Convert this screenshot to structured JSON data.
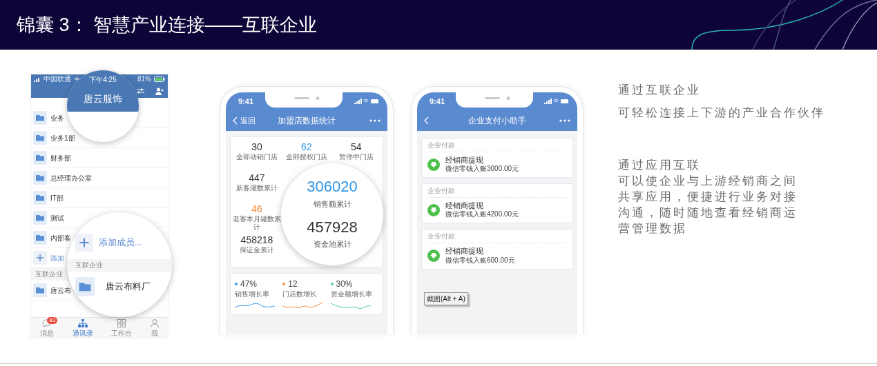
{
  "header": {
    "title": "锦囊 3： 智慧产业连接——互联企业"
  },
  "contacts_phone": {
    "carrier": "中国联通",
    "battery": "81%",
    "groups": [
      {
        "label": "业务"
      },
      {
        "label": "业务1部"
      },
      {
        "label": "财务部"
      },
      {
        "label": "总经理办公室"
      },
      {
        "label": "IT部"
      },
      {
        "label": "测试"
      },
      {
        "label": "内部客"
      }
    ],
    "add_member": "添加",
    "section": "互联企业",
    "partners": [
      {
        "label": "唐云布"
      }
    ],
    "tabs": [
      {
        "label": "消息",
        "badge": "83",
        "selected": false
      },
      {
        "label": "通讯录",
        "selected": true
      },
      {
        "label": "工作台",
        "selected": false
      },
      {
        "label": "我",
        "selected": false
      }
    ],
    "magnifier_top": {
      "time": "下午4:25",
      "title": "唐云服饰"
    },
    "magnifier_bottom": {
      "add_member": "添加成员...",
      "section": "互联企业",
      "partner": "唐云布料厂"
    }
  },
  "dashboard_phone": {
    "time": "9:41",
    "back": "返回",
    "title": "加盟店数据统计",
    "stat_rows": [
      [
        {
          "value": "30",
          "label": "全部动销门店"
        },
        {
          "value": "62",
          "label": "全部授权门店",
          "color": "#2f96e8"
        },
        {
          "value": "54",
          "label": "暂停中门店"
        }
      ],
      [
        {
          "value": "447",
          "label": "新客灌数累计"
        }
      ],
      [
        {
          "value": "46",
          "label": "老客本月罐数累计",
          "color": "#f08a3c"
        }
      ],
      [
        {
          "value": "458218",
          "label": "保证金累计"
        }
      ]
    ],
    "magnifier": [
      {
        "value": "306020",
        "label": "销售额累计",
        "color": "#2f96e8"
      },
      {
        "value": "457928",
        "label": "资金池累计"
      }
    ],
    "growth": [
      {
        "value": "47%",
        "label": "销售增长率",
        "color": "#3a9be8"
      },
      {
        "value": "12",
        "label": "门店数增长",
        "color": "#f08a3c"
      },
      {
        "value": "30%",
        "label": "资金额增长率",
        "color": "#4cc9b0"
      }
    ]
  },
  "payment_phone": {
    "time": "9:41",
    "title": "企业支付小助手",
    "cards": [
      {
        "category": "企业付款",
        "title": "经销商提现",
        "detail": "微信零钱入账3000.00元"
      },
      {
        "category": "企业付款",
        "title": "经销商提现",
        "detail": "微信零钱入账4200.00元"
      },
      {
        "category": "企业付款",
        "title": "经销商提现",
        "detail": "微信零钱入账600.00元"
      }
    ],
    "tooltip": "截图(Alt + A)"
  },
  "description": [
    {
      "lines": [
        "通过互联企业",
        "可轻松连接上下游的产业合作伙伴"
      ]
    },
    {
      "lines": [
        "通过应用互联",
        "可以使企业与上游经销商之间",
        "共享应用，便捷进行业务对接",
        "沟通，随时随地查看经销商运",
        "营管理数据"
      ]
    }
  ]
}
